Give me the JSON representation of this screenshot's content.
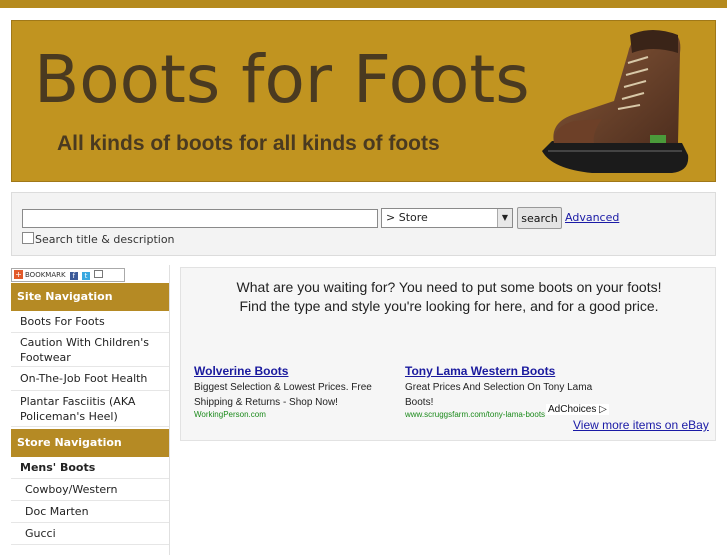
{
  "banner": {
    "title": "Boots for Foots",
    "subtitle": "All kinds of boots for all kinds of foots"
  },
  "search": {
    "input_value": "",
    "store_option": "> Store",
    "button_label": "search",
    "advanced_label": "Advanced",
    "description_label": "Search title & description"
  },
  "bookmark": {
    "label": "BOOKMARK"
  },
  "sidebar": {
    "site_nav_header": "Site Navigation",
    "site_items": [
      {
        "label": "Boots For Foots"
      },
      {
        "label": "Caution With Children's Footwear"
      },
      {
        "label": "On-The-Job Foot Health"
      },
      {
        "label": "Plantar Fasciitis (AKA Policeman's Heel)"
      }
    ],
    "store_nav_header": "Store Navigation",
    "store_items": [
      {
        "label": "Mens' Boots"
      },
      {
        "label": "Cowboy/Western"
      },
      {
        "label": "Doc Marten"
      },
      {
        "label": "Gucci"
      }
    ]
  },
  "main": {
    "intro_line1": "What are you waiting for? You need to put some boots on your foots!",
    "intro_line2": "Find the type and style you're looking for here, and for a good price.",
    "ads": [
      {
        "title": "Wolverine Boots",
        "body": "Biggest Selection & Lowest Prices. Free Shipping & Returns - Shop Now!",
        "url": "WorkingPerson.com"
      },
      {
        "title": "Tony Lama Western Boots",
        "body": "Great Prices And Selection On Tony Lama Boots!",
        "url": "www.scruggsfarm.com/tony-lama-boots"
      }
    ],
    "adchoices_label": "AdChoices ▷",
    "ebay_label": "View more items on eBay"
  },
  "colors": {
    "banner": "#c19420",
    "nav_header": "#b58a24",
    "link": "#1a1aa6"
  }
}
